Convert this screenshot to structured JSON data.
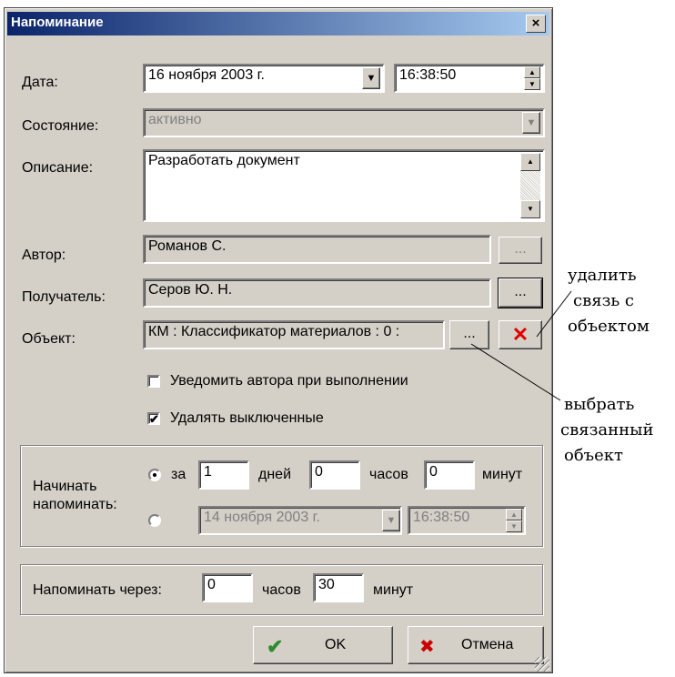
{
  "dialog": {
    "title": "Напоминание",
    "close_glyph": "×"
  },
  "fields": {
    "date_label": "Дата:",
    "date_value": "16  ноября  2003 г.",
    "time_value": "16:38:50",
    "state_label": "Состояние:",
    "state_value": "активно",
    "description_label": "Описание:",
    "description_value": "Разработать документ",
    "author_label": "Автор:",
    "author_value": "Романов С.",
    "recipient_label": "Получатель:",
    "recipient_value": "Серов Ю. Н.",
    "object_label": "Объект:",
    "object_value": "КМ : Классификатор материалов : 0 :",
    "browse_label": "..."
  },
  "checkboxes": {
    "notify_author": {
      "label": "Уведомить автора при выполнении",
      "checked": false
    },
    "delete_disabled": {
      "label": "Удалять выключенные",
      "checked": true,
      "mark": "✔"
    }
  },
  "start_group": {
    "label_line1": "Начинать",
    "label_line2": "напоминать:",
    "option_in": "за",
    "days_value": "1",
    "days_label": "дней",
    "hours_value": "0",
    "hours_label": "часов",
    "minutes_value": "0",
    "minutes_label": "минут",
    "date_value": "14  ноября  2003 г.",
    "time_value": "16:38:50",
    "selected": "relative"
  },
  "repeat_group": {
    "label": "Напоминать через:",
    "hours_value": "0",
    "hours_label": "часов",
    "minutes_value": "30",
    "minutes_label": "минут"
  },
  "buttons": {
    "ok_label": "OK",
    "ok_icon": "✔",
    "cancel_label": "Отмена",
    "cancel_icon": "✖",
    "delete_icon": "✕"
  },
  "annotations": {
    "delete_link_line1": "удалить",
    "delete_link_line2": "связь с",
    "delete_link_line3": "объектом",
    "select_object_line1": "выбрать",
    "select_object_line2": "связанный",
    "select_object_line3": "объект"
  },
  "colors": {
    "dialog_bg": "#d4d0c8",
    "title_start": "#0a246a",
    "title_end": "#a6caf0",
    "ok_check": "#2e8b2e",
    "cancel_x": "#cc0000"
  }
}
